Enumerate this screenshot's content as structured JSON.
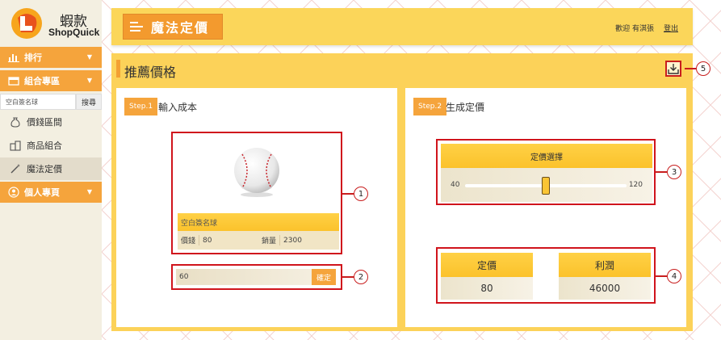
{
  "brand": {
    "name_cn": "蝦款",
    "name_en": "ShopQuick"
  },
  "sidebar": {
    "ranking_label": "排行",
    "combo_label": "組合專區",
    "search": {
      "value": "空白簽名球",
      "button": "搜尋"
    },
    "items": [
      {
        "label": "價錢區間",
        "icon": "moneybag-icon"
      },
      {
        "label": "商品組合",
        "icon": "boxes-icon"
      },
      {
        "label": "魔法定價",
        "icon": "magic-wand-icon"
      }
    ],
    "personal_label": "個人專頁"
  },
  "header": {
    "title": "魔法定價",
    "welcome": "歡迎 有淇張",
    "logout": "登出"
  },
  "main": {
    "section_title": "推薦價格",
    "step1": {
      "badge": "Step.1",
      "title": "輸入成本",
      "product": {
        "name": "空白簽名球",
        "price_label": "價錢",
        "price": "80",
        "sales_label": "銷量",
        "sales": "2300"
      },
      "cost_input": "60",
      "confirm": "確定"
    },
    "step2": {
      "badge": "Step.2",
      "title": "生成定價",
      "slider": {
        "label": "定價選擇",
        "min": "40",
        "max": "120",
        "value": 80
      },
      "price_label": "定價",
      "price_value": "80",
      "profit_label": "利潤",
      "profit_value": "46000"
    }
  },
  "callouts": [
    "1",
    "2",
    "3",
    "4",
    "5"
  ],
  "colors": {
    "accent": "#f5a43c",
    "yellow": "#fcd259",
    "highlight": "#d0141c"
  }
}
